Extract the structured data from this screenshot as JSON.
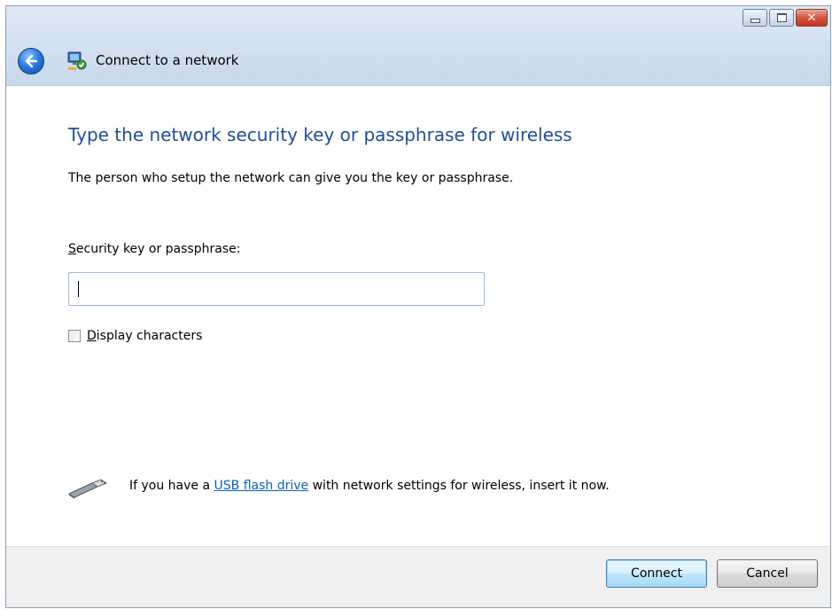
{
  "window": {
    "title": "Connect to a network",
    "close_glyph": "✕"
  },
  "heading": "Type the network security key or passphrase for wireless",
  "description": "The person who setup the network can give you the key or passphrase.",
  "key_field": {
    "label_access_key": "S",
    "label_rest": "ecurity key or passphrase:",
    "value": ""
  },
  "display_characters": {
    "label_access_key": "D",
    "label_rest": "isplay characters",
    "checked": false
  },
  "usb": {
    "prefix": "If you have a ",
    "link": "USB flash drive",
    "suffix": " with network settings for wireless, insert it now."
  },
  "buttons": {
    "connect": "Connect",
    "cancel": "Cancel"
  },
  "icons": {
    "back": "back-arrow-icon",
    "app": "network-connect-icon",
    "usb": "usb-flash-drive-icon"
  },
  "colors": {
    "heading": "#1f4e9b",
    "link": "#0b5fc4",
    "accent_button_border": "#3c7fb1"
  }
}
